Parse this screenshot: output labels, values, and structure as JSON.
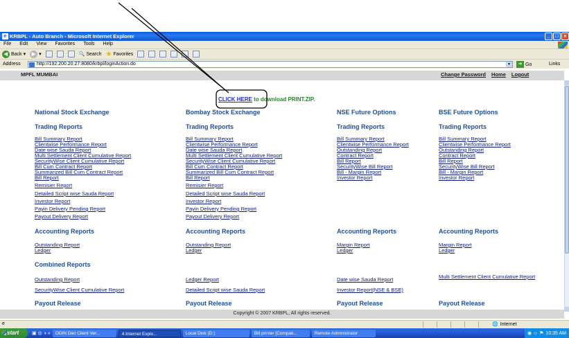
{
  "window": {
    "title": "KRBPL - Auto Branch - Microsoft Internet Explorer"
  },
  "menu": [
    "File",
    "Edit",
    "View",
    "Favorites",
    "Tools",
    "Help"
  ],
  "toolbar": {
    "back": "Back",
    "search": "Search",
    "favorites": "Favorites"
  },
  "address": {
    "label": "Address",
    "url": "http://192.200.20.27:8080/krbpl/loginAction.do",
    "go": "Go",
    "links": "Links"
  },
  "page": {
    "org": "MPFL MUMBAI",
    "top_links": [
      "Change Password",
      "Home",
      "Logout"
    ],
    "download_link": "CLICK HERE",
    "download_text": " to download PRINT.ZIP.",
    "columns": [
      {
        "exchange": "National Stock Exchange",
        "trading_heading": "Trading Reports",
        "trading": [
          "Bill Summary Report",
          "Clientwise Performance Report",
          "Date wise Sauda Report",
          "Multi Settlement Client Cumulative Report",
          "SecurityWise Client Cumulative Report",
          "Bill Cum Contract Report",
          "Summarized Bill Cum Contract Report",
          "Bill Report",
          "Remisier Report",
          "Detailed Script wise Sauda Report",
          "Investor Report",
          "Payin Delivery Pending Report",
          "Payout Delivery Report"
        ],
        "accounting_heading": "Accounting Reports",
        "accounting": [
          "Outstanding Report",
          "Ledger"
        ],
        "payout_heading": "Payout Release"
      },
      {
        "exchange": "Bombay Stock Exchange",
        "trading_heading": "Trading Reports",
        "trading": [
          "Bill Summary Report",
          "Clientwise Performance Report",
          "Date wise Sauda Report",
          "Multi Settlement Client Cumulative Report",
          "SecurityWise Client Cumulative Report",
          "Bill Cum Contract Report",
          "Summarized Bill Cum Contract Report",
          "Bill Report",
          "Remisier Report",
          "Detailed Script wise Sauda Report",
          "Investor Report",
          "Payin Delivery Pending Report",
          "Payout Delivery Report"
        ],
        "accounting_heading": "Accounting Reports",
        "accounting": [
          "Outstanding Report",
          "Ledger"
        ],
        "payout_heading": "Payout Release"
      },
      {
        "exchange": "NSE Future Options",
        "trading_heading": "Trading Reports",
        "trading": [
          "Bill Summary Report",
          "Clientwise Performance Report",
          "Outstanding Report",
          "Contract Report",
          "Bill Report",
          "SecurityWise Bill Report",
          "Bill - Margin Report",
          "Investor Report"
        ],
        "accounting_heading": "Accounting Reports",
        "accounting": [
          "Margin Report",
          "Ledger"
        ],
        "payout_heading": "Payout Release"
      },
      {
        "exchange": "BSE Future Options",
        "trading_heading": "Trading Reports",
        "trading": [
          "Bill Summary Report",
          "Clientwise Performance Report",
          "Outstanding Report",
          "Contract Report",
          "Bill Report",
          "SecurityWise Bill Report",
          "Bill - Margin Report",
          "Investor Report"
        ],
        "accounting_heading": "Accounting Reports",
        "accounting": [
          "Margin Report",
          "Ledger"
        ],
        "payout_heading": "Payout Release"
      }
    ],
    "combined_heading": "Combined Reports",
    "combined": [
      [
        "Outstanding Report",
        "Ledger Report",
        "Date wise Sauda Report",
        "Multi Settlement Client Cumulative Report"
      ],
      [
        "SecurityWise Client Cumulative Report",
        "Detailed Script wise Sauda Report",
        "Investor Report(NSE & BSE)"
      ]
    ],
    "footer": "Copyright © 2007 KRBPL, All rights reserved."
  },
  "status": {
    "zone": "Internet"
  },
  "taskbar": {
    "start": "start",
    "tasks": [
      "ODIN Diet Client Ver...",
      "4 Internet Explo...",
      "Local Disk (D:)",
      "Bill printer [Compati...",
      "Remote Administrator"
    ],
    "clock": "10:35 AM"
  }
}
